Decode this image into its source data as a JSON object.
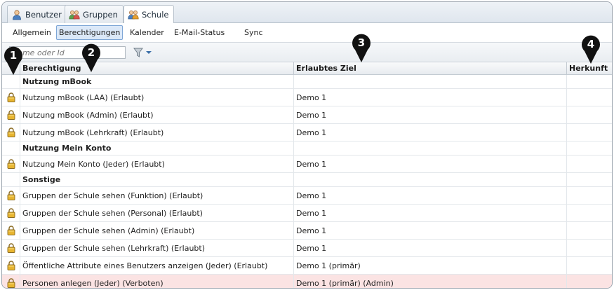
{
  "tabs": [
    {
      "label": "Benutzer",
      "icon": "user-icon",
      "active": false
    },
    {
      "label": "Gruppen",
      "icon": "group-icon",
      "active": false
    },
    {
      "label": "Schule",
      "icon": "school-icon",
      "active": true
    }
  ],
  "subnav": [
    {
      "label": "Allgemein",
      "active": false
    },
    {
      "label": "Berechtigungen",
      "active": true
    },
    {
      "label": "Kalender",
      "active": false
    },
    {
      "label": "E-Mail-Status",
      "active": false
    },
    {
      "label": "Sync",
      "active": false
    }
  ],
  "filter": {
    "placeholder": "Name oder Id",
    "icon": "filter-icon"
  },
  "columns": {
    "permission": "Berechtigung",
    "target": "Erlaubtes Ziel",
    "origin": "Herkunft"
  },
  "rows": [
    {
      "type": "group",
      "permission": "Nutzung mBook",
      "target": "",
      "origin": ""
    },
    {
      "type": "item",
      "permission": "Nutzung mBook (LAA) (Erlaubt)",
      "target": "Demo 1",
      "origin": ""
    },
    {
      "type": "item",
      "permission": "Nutzung mBook (Admin) (Erlaubt)",
      "target": "Demo 1",
      "origin": ""
    },
    {
      "type": "item",
      "permission": "Nutzung mBook (Lehrkraft) (Erlaubt)",
      "target": "Demo 1",
      "origin": ""
    },
    {
      "type": "group",
      "permission": "Nutzung Mein Konto",
      "target": "",
      "origin": ""
    },
    {
      "type": "item",
      "permission": "Nutzung Mein Konto (Jeder) (Erlaubt)",
      "target": "Demo 1",
      "origin": ""
    },
    {
      "type": "group",
      "permission": "Sonstige",
      "target": "",
      "origin": ""
    },
    {
      "type": "item",
      "permission": "Gruppen der Schule sehen (Funktion) (Erlaubt)",
      "target": "Demo 1",
      "origin": ""
    },
    {
      "type": "item",
      "permission": "Gruppen der Schule sehen (Personal) (Erlaubt)",
      "target": "Demo 1",
      "origin": ""
    },
    {
      "type": "item",
      "permission": "Gruppen der Schule sehen (Admin) (Erlaubt)",
      "target": "Demo 1",
      "origin": ""
    },
    {
      "type": "item",
      "permission": "Gruppen der Schule sehen (Lehrkraft) (Erlaubt)",
      "target": "Demo 1",
      "origin": ""
    },
    {
      "type": "item",
      "permission": "Öffentliche Attribute eines Benutzers anzeigen (Jeder) (Erlaubt)",
      "target": "Demo 1 (primär)",
      "origin": ""
    },
    {
      "type": "forbidden",
      "permission": "Personen anlegen (Jeder) (Verboten)",
      "target": "Demo 1 (primär) (Admin)",
      "origin": ""
    }
  ],
  "markers": [
    "1",
    "2",
    "3",
    "4"
  ],
  "colors": {
    "accent": "#7ea6d6",
    "forbidden_row": "#fbe3e3",
    "lock": "#e8b530",
    "marker": "#111111"
  }
}
